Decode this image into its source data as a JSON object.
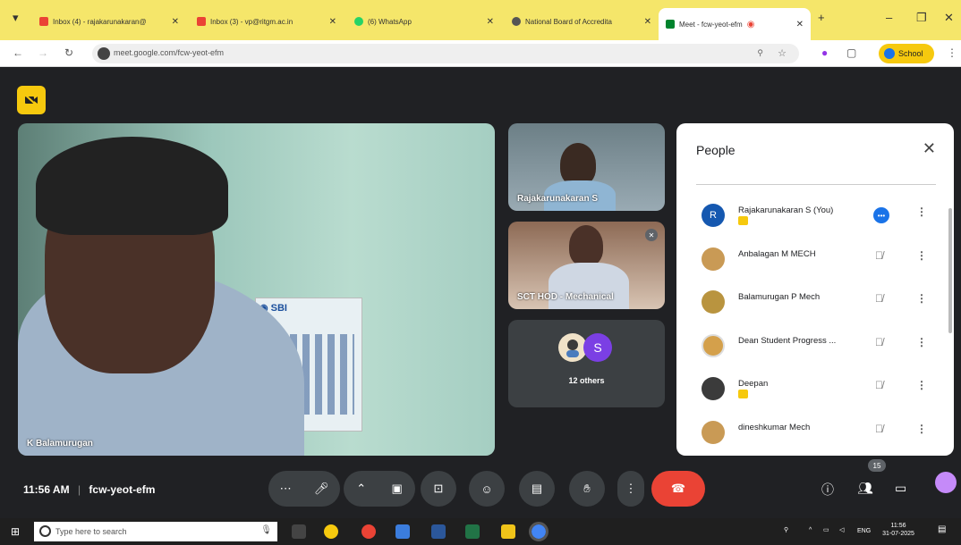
{
  "browser": {
    "tabs": [
      {
        "label": "Inbox (4) - rajakarunakaran@",
        "fav_color": "#ea4335"
      },
      {
        "label": "Inbox (3) - vp@ritgm.ac.in",
        "fav_color": "#ea4335"
      },
      {
        "label": "(6) WhatsApp",
        "fav_color": "#25d366"
      },
      {
        "label": "National Board of Accredita",
        "fav_color": "#555555"
      },
      {
        "label": "Meet - fcw-yeot-efm",
        "fav_color": "#00832d"
      }
    ],
    "url": "meet.google.com/fcw-yeot-efm",
    "profile_label": "School"
  },
  "meet": {
    "main_tile_name": "K Balamurugan",
    "tiles": [
      {
        "name": "Rajakarunakaran S"
      },
      {
        "name": "SCT HOD - Mechanical"
      }
    ],
    "others_avatar_letter": "S",
    "others_label": "12 others",
    "time": "11:56 AM",
    "meeting_code": "fcw-yeot-efm",
    "participants_count": "15",
    "people_panel": {
      "title": "People",
      "participants": [
        {
          "name": "Rajakarunakaran S (You)",
          "initial": "R",
          "color": "#1558b0",
          "muted": false
        },
        {
          "name": "Anbalagan M MECH",
          "initial": "",
          "color": "#c99a55",
          "muted": true
        },
        {
          "name": "Balamurugan P Mech",
          "initial": "",
          "color": "#b9943f",
          "muted": true
        },
        {
          "name": "Dean Student Progress ...",
          "initial": "",
          "color": "#d4a04b",
          "muted": true
        },
        {
          "name": "Deepan",
          "initial": "",
          "color": "#3b3b3b",
          "muted": true
        },
        {
          "name": "dineshkumar Mech",
          "initial": "",
          "color": "#c99a55",
          "muted": true
        }
      ]
    }
  },
  "taskbar": {
    "search_placeholder": "Type here to search",
    "lang": "ENG",
    "clock_time": "11:56",
    "clock_date": "31-07-2025"
  }
}
